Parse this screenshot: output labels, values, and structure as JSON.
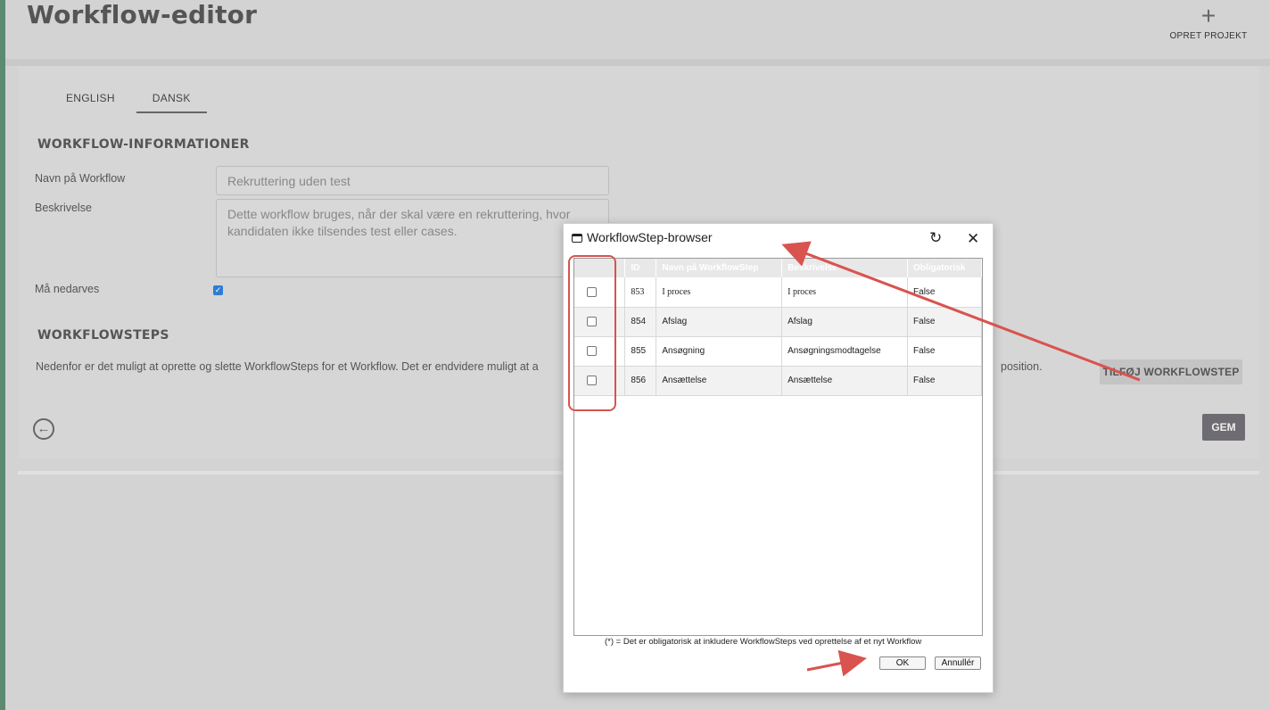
{
  "header": {
    "title": "Workflow-editor",
    "create_project_label": "OPRET PROJEKT"
  },
  "tabs": [
    {
      "label": "ENGLISH",
      "active": false
    },
    {
      "label": "DANSK",
      "active": true
    }
  ],
  "info_section": {
    "title": "WORKFLOW-INFORMATIONER",
    "name_label": "Navn på Workflow",
    "name_value": "Rekruttering uden test",
    "description_label": "Beskrivelse",
    "description_value": "Dette workflow bruges, når der skal være en rekruttering, hvor kandidaten ikke tilsendes test eller cases.",
    "inherit_label": "Må nedarves",
    "inherit_checked": true
  },
  "steps_section": {
    "title": "WORKFLOWSTEPS",
    "description": "Nedenfor er det muligt at oprette og slette WorkflowSteps for et Workflow. Det er endvidere muligt at a",
    "description_end": "position.",
    "add_button": "TILFØJ WORKFLOWSTEP"
  },
  "footer": {
    "save_button": "GEM"
  },
  "modal": {
    "title": "WorkflowStep-browser",
    "columns": [
      "",
      "ID",
      "Navn på WorkflowStep",
      "Beskrivelse",
      "Obligatorisk"
    ],
    "rows": [
      {
        "id": "853",
        "name": "I proces",
        "description": "I proces",
        "mandatory": "False"
      },
      {
        "id": "854",
        "name": "Afslag",
        "description": "Afslag",
        "mandatory": "False"
      },
      {
        "id": "855",
        "name": "Ansøgning",
        "description": "Ansøgningsmodtagelse",
        "mandatory": "False"
      },
      {
        "id": "856",
        "name": "Ansættelse",
        "description": "Ansættelse",
        "mandatory": "False"
      }
    ],
    "note": "(*) = Det er obligatorisk at inkludere WorkflowSteps ved oprettelse af et nyt Workflow",
    "ok_button": "OK",
    "cancel_button": "Annullér"
  },
  "colors": {
    "annotation": "#d9534f",
    "accent_strip": "#5d8a70",
    "checkbox": "#2d7cd6"
  }
}
